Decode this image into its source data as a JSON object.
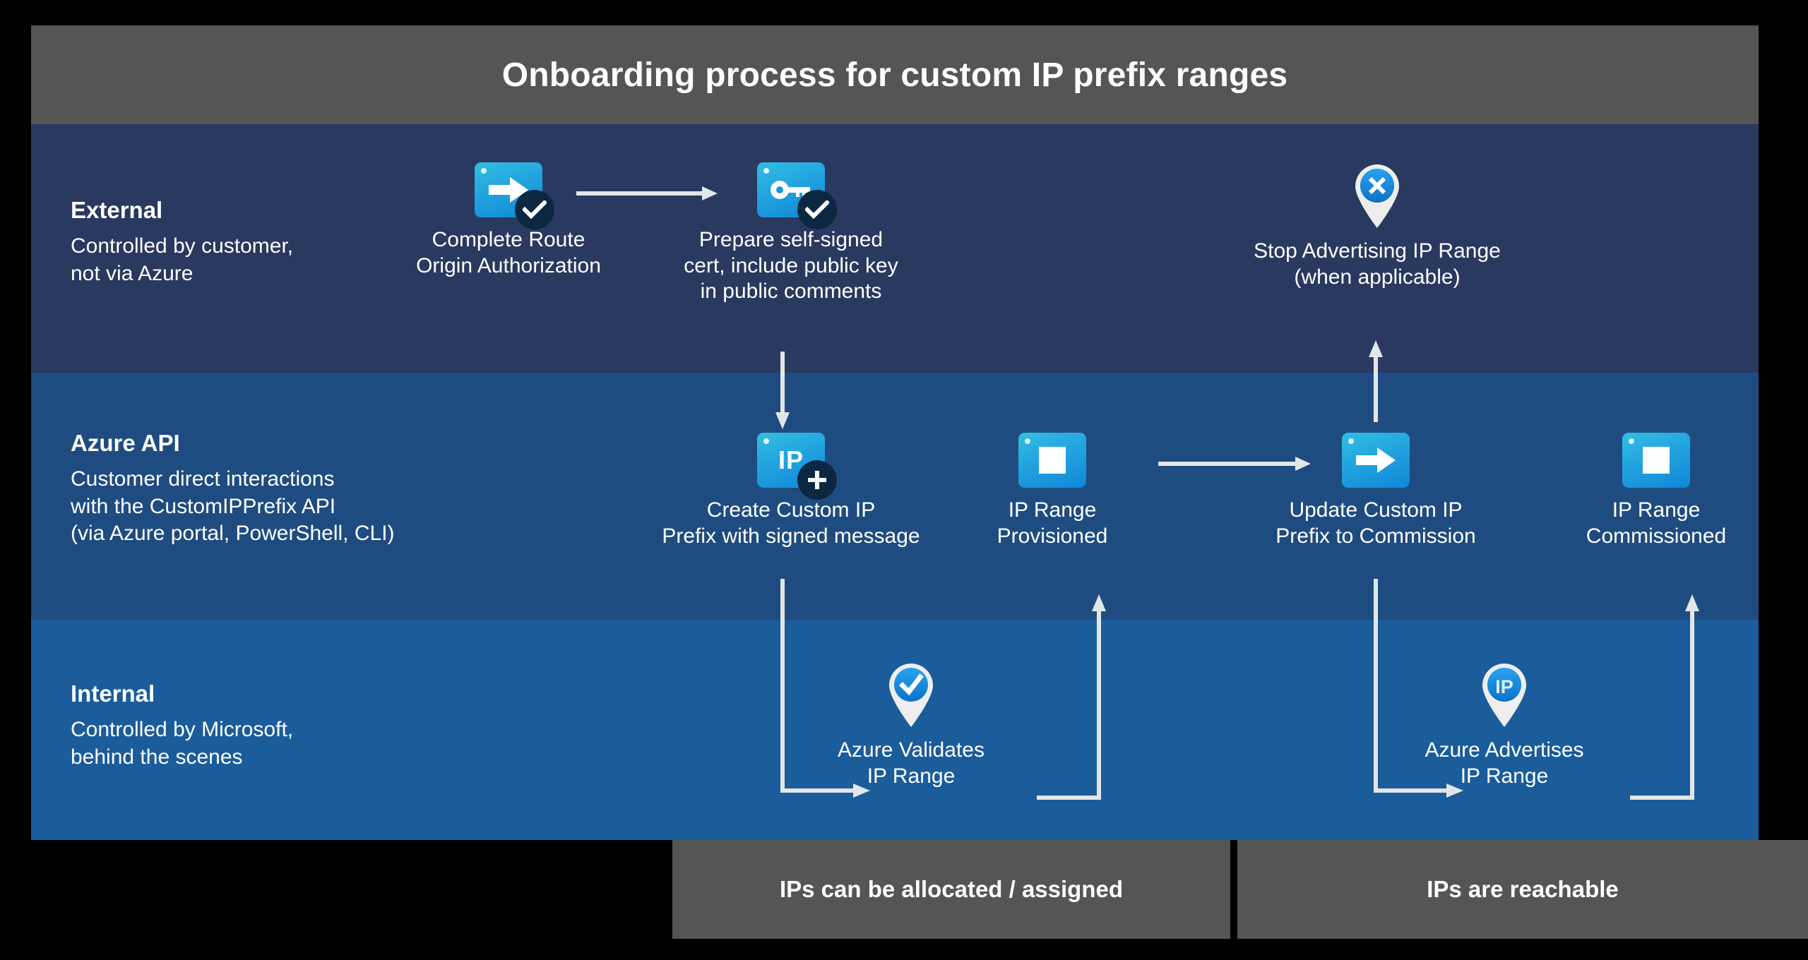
{
  "title": "Onboarding process for custom IP prefix ranges",
  "lanes": [
    {
      "id": "external",
      "title": "External",
      "subtitle": "Controlled by customer,\nnot via Azure",
      "color": "#29395f"
    },
    {
      "id": "azure-api",
      "title": "Azure API",
      "subtitle": "Customer direct interactions\nwith the CustomIPPrefix API\n(via Azure portal, PowerShell, CLI)",
      "color": "#1f4c80"
    },
    {
      "id": "internal",
      "title": "Internal",
      "subtitle": "Controlled by Microsoft,\nbehind the scenes",
      "color": "#1b5c9b"
    }
  ],
  "nodes": {
    "complete_route": {
      "caption": "Complete Route\nOrigin Authorization",
      "icon": "arrow-right-tile-icon",
      "badge": "check-badge-icon"
    },
    "prepare_cert": {
      "caption": "Prepare self-signed\ncert, include public key\nin public comments",
      "icon": "key-tile-icon",
      "badge": "check-badge-icon"
    },
    "stop_advertising": {
      "caption": "Stop Advertising IP Range\n(when applicable)",
      "icon": "pin-x-icon"
    },
    "create_prefix": {
      "caption": "Create Custom IP\nPrefix with signed message",
      "icon": "ip-tile-icon",
      "badge": "plus-badge-icon"
    },
    "range_provisioned": {
      "caption": "IP Range\nProvisioned",
      "icon": "square-tile-icon"
    },
    "update_prefix": {
      "caption": "Update Custom IP\nPrefix to Commission",
      "icon": "arrow-right-tile-icon"
    },
    "range_commissioned": {
      "caption": "IP Range\nCommissioned",
      "icon": "square-tile-icon"
    },
    "azure_validates": {
      "caption": "Azure Validates\nIP Range",
      "icon": "pin-check-icon"
    },
    "azure_advertises": {
      "caption": "Azure Advertises\nIP Range",
      "icon": "pin-ip-icon"
    }
  },
  "footers": [
    {
      "id": "allocated",
      "label": "IPs can be allocated / assigned"
    },
    {
      "id": "reachable",
      "label": "IPs are reachable"
    }
  ],
  "colors": {
    "title_bar": "#555555",
    "external_band": "#29395f",
    "api_band": "#1f4c80",
    "internal_band": "#1b5c9b",
    "connector": "#e3e6e8",
    "tile_top": "#32bfe0",
    "tile_bottom": "#0f87d8",
    "badge": "#0b2741",
    "pin_body": "#eeeeee",
    "pin_circle": "#1a8ae0"
  }
}
